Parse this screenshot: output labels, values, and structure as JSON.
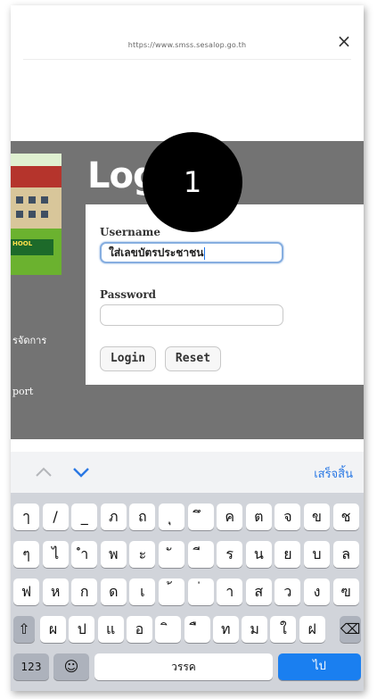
{
  "browser": {
    "url": "https://www.smss.sesalop.go.th",
    "close_icon": "×"
  },
  "page": {
    "login_title": "Log",
    "school_banner": "HOOL",
    "side_text_1": "รจัดการ",
    "side_text_2": "port",
    "username_label": "Username",
    "username_value": "ใส่เลขบัตรประชาชน",
    "password_label": "Password",
    "password_value": "",
    "login_button": "Login",
    "reset_button": "Reset"
  },
  "callout": {
    "number": "1"
  },
  "accessory": {
    "done_label": "เสร็จสิ้น"
  },
  "keyboard": {
    "row1": [
      "ๅ",
      "/",
      "_",
      "ภ",
      "ถ",
      "ุ",
      "ึ",
      "ค",
      "ต",
      "จ",
      "ข",
      "ช"
    ],
    "row2": [
      "ๆ",
      "ไ",
      "ำ",
      "พ",
      "ะ",
      "ั",
      "ี",
      "ร",
      "น",
      "ย",
      "บ",
      "ล"
    ],
    "row3": [
      "ฟ",
      "ห",
      "ก",
      "ด",
      "เ",
      "้",
      "่",
      "า",
      "ส",
      "ว",
      "ง",
      "ฃ"
    ],
    "row4": [
      "ผ",
      "ป",
      "แ",
      "อ",
      "ิ",
      "ื",
      "ท",
      "ม",
      "ใ",
      "ฝ"
    ],
    "shift": "⇧",
    "backspace": "⌫",
    "numbers": "123",
    "emoji": "☺",
    "space": "วรรค",
    "go": "ไป"
  }
}
